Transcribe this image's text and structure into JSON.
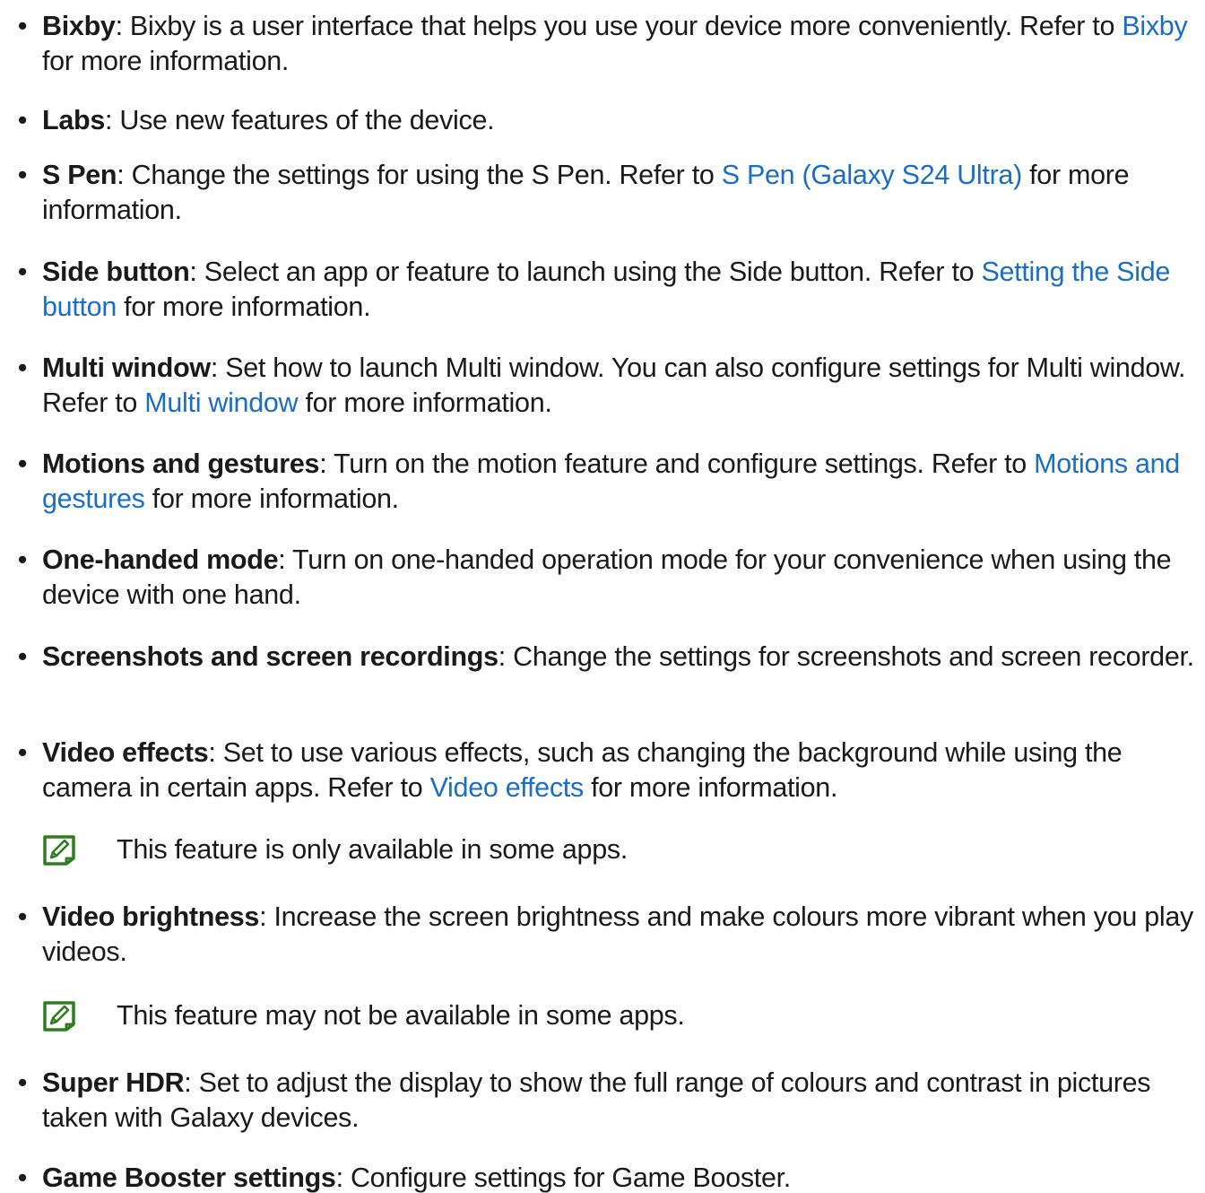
{
  "accent_color": "#1a6ec4",
  "note_icon_color": "#2e7d1f",
  "bullet_char": "•",
  "items": [
    {
      "term": "Bixby",
      "sep": ": ",
      "desc1": "Bixby is a user interface that helps you use your device more conveniently. Refer to ",
      "link": "Bixby",
      "desc2": " for more information."
    },
    {
      "term": "Labs",
      "sep": ": ",
      "desc1": "Use new features of the device."
    },
    {
      "term": "S Pen",
      "sep": ": ",
      "desc1": "Change the settings for using the S Pen. Refer to ",
      "link": "S Pen (Galaxy S24 Ultra)",
      "desc2": " for more information."
    },
    {
      "term": "Side button",
      "sep": ": ",
      "desc1": "Select an app or feature to launch using the Side button. Refer to ",
      "link": "Setting the Side button",
      "desc2": " for more information."
    },
    {
      "term": "Multi window",
      "sep": ": ",
      "desc1": "Set how to launch Multi window. You can also configure settings for Multi window. Refer to ",
      "link": "Multi window",
      "desc2": " for more information."
    },
    {
      "term": "Motions and gestures",
      "sep": ": ",
      "desc1": "Turn on the motion feature and configure settings. Refer to ",
      "link": "Motions and gestures",
      "desc2": " for more information."
    },
    {
      "term": "One-handed mode",
      "sep": ": ",
      "desc1": "Turn on one-handed operation mode for your convenience when using the device with one hand."
    },
    {
      "term": "Screenshots and screen recordings",
      "sep": ": ",
      "desc1": "Change the settings for screenshots and screen recorder."
    },
    {
      "term": "Video effects",
      "sep": ": ",
      "desc1": "Set to use various effects, such as changing the background while using the camera in certain apps. Refer to ",
      "link": "Video effects",
      "desc2": " for more information."
    },
    {
      "term": "Video brightness",
      "sep": ": ",
      "desc1": "Increase the screen brightness and make colours more vibrant when you play videos."
    },
    {
      "term": "Super HDR",
      "sep": ": ",
      "desc1": "Set to adjust the display to show the full range of colours and contrast in pictures taken with Galaxy devices."
    },
    {
      "term": "Game Booster settings",
      "sep": ": ",
      "desc1": "Configure settings for Game Booster."
    }
  ],
  "notes": [
    {
      "text": "This feature is only available in some apps."
    },
    {
      "text": "This feature may not be available in some apps."
    }
  ]
}
